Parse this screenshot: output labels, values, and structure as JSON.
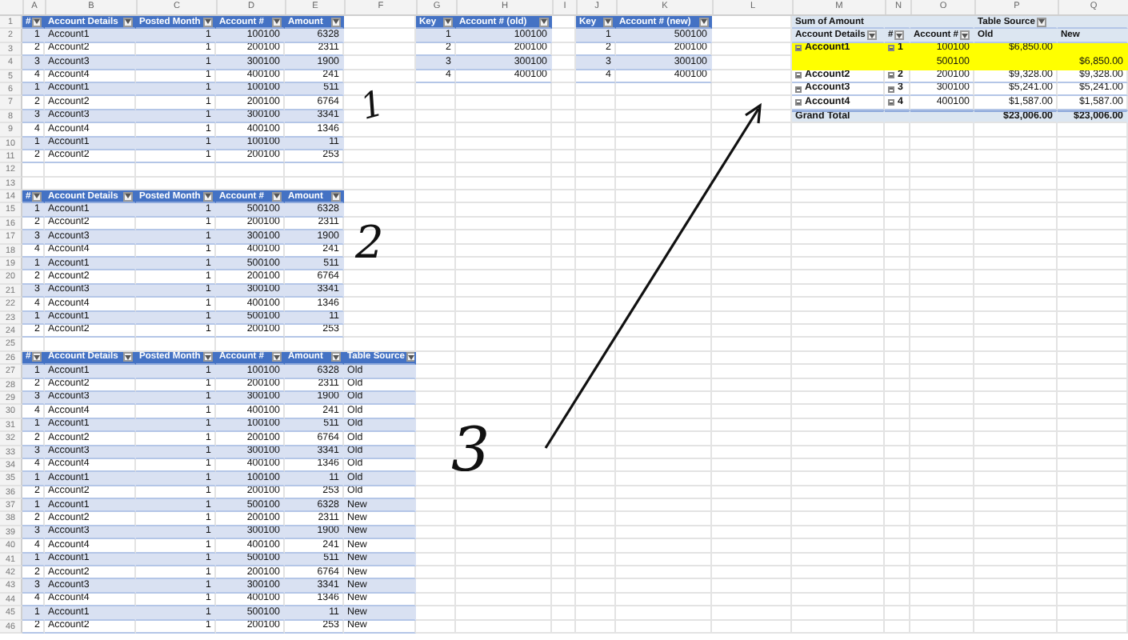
{
  "column_letters": [
    "A",
    "B",
    "C",
    "D",
    "E",
    "F",
    "G",
    "H",
    "I",
    "J",
    "K",
    "L",
    "M",
    "N",
    "O",
    "P",
    "Q"
  ],
  "row_numbers": [
    "1",
    "2",
    "3",
    "4",
    "5",
    "6",
    "7",
    "8",
    "9",
    "10",
    "11",
    "12",
    "13",
    "14",
    "15",
    "16",
    "17",
    "18",
    "19",
    "20",
    "21",
    "22",
    "23",
    "24",
    "25",
    "26",
    "27",
    "28",
    "29",
    "30",
    "31",
    "32",
    "33",
    "34",
    "35",
    "36",
    "37",
    "38",
    "39",
    "40",
    "41",
    "42",
    "43",
    "44",
    "45",
    "46"
  ],
  "tables": [
    {
      "headers": [
        "#",
        "Account Details",
        "Posted Month",
        "Account #",
        "Amount"
      ],
      "rows": [
        [
          "1",
          "Account1",
          "1",
          "100100",
          "6328"
        ],
        [
          "2",
          "Account2",
          "1",
          "200100",
          "2311"
        ],
        [
          "3",
          "Account3",
          "1",
          "300100",
          "1900"
        ],
        [
          "4",
          "Account4",
          "1",
          "400100",
          "241"
        ],
        [
          "1",
          "Account1",
          "1",
          "100100",
          "511"
        ],
        [
          "2",
          "Account2",
          "1",
          "200100",
          "6764"
        ],
        [
          "3",
          "Account3",
          "1",
          "300100",
          "3341"
        ],
        [
          "4",
          "Account4",
          "1",
          "400100",
          "1346"
        ],
        [
          "1",
          "Account1",
          "1",
          "100100",
          "11"
        ],
        [
          "2",
          "Account2",
          "1",
          "200100",
          "253"
        ]
      ]
    },
    {
      "headers": [
        "#",
        "Account Details",
        "Posted Month",
        "Account #",
        "Amount"
      ],
      "rows": [
        [
          "1",
          "Account1",
          "1",
          "500100",
          "6328"
        ],
        [
          "2",
          "Account2",
          "1",
          "200100",
          "2311"
        ],
        [
          "3",
          "Account3",
          "1",
          "300100",
          "1900"
        ],
        [
          "4",
          "Account4",
          "1",
          "400100",
          "241"
        ],
        [
          "1",
          "Account1",
          "1",
          "500100",
          "511"
        ],
        [
          "2",
          "Account2",
          "1",
          "200100",
          "6764"
        ],
        [
          "3",
          "Account3",
          "1",
          "300100",
          "3341"
        ],
        [
          "4",
          "Account4",
          "1",
          "400100",
          "1346"
        ],
        [
          "1",
          "Account1",
          "1",
          "500100",
          "11"
        ],
        [
          "2",
          "Account2",
          "1",
          "200100",
          "253"
        ]
      ]
    },
    {
      "headers": [
        "#",
        "Account Details",
        "Posted Month",
        "Account #",
        "Amount",
        "Table Source"
      ],
      "rows": [
        [
          "1",
          "Account1",
          "1",
          "100100",
          "6328",
          "Old"
        ],
        [
          "2",
          "Account2",
          "1",
          "200100",
          "2311",
          "Old"
        ],
        [
          "3",
          "Account3",
          "1",
          "300100",
          "1900",
          "Old"
        ],
        [
          "4",
          "Account4",
          "1",
          "400100",
          "241",
          "Old"
        ],
        [
          "1",
          "Account1",
          "1",
          "100100",
          "511",
          "Old"
        ],
        [
          "2",
          "Account2",
          "1",
          "200100",
          "6764",
          "Old"
        ],
        [
          "3",
          "Account3",
          "1",
          "300100",
          "3341",
          "Old"
        ],
        [
          "4",
          "Account4",
          "1",
          "400100",
          "1346",
          "Old"
        ],
        [
          "1",
          "Account1",
          "1",
          "100100",
          "11",
          "Old"
        ],
        [
          "2",
          "Account2",
          "1",
          "200100",
          "253",
          "Old"
        ],
        [
          "1",
          "Account1",
          "1",
          "500100",
          "6328",
          "New"
        ],
        [
          "2",
          "Account2",
          "1",
          "200100",
          "2311",
          "New"
        ],
        [
          "3",
          "Account3",
          "1",
          "300100",
          "1900",
          "New"
        ],
        [
          "4",
          "Account4",
          "1",
          "400100",
          "241",
          "New"
        ],
        [
          "1",
          "Account1",
          "1",
          "500100",
          "511",
          "New"
        ],
        [
          "2",
          "Account2",
          "1",
          "200100",
          "6764",
          "New"
        ],
        [
          "3",
          "Account3",
          "1",
          "300100",
          "3341",
          "New"
        ],
        [
          "4",
          "Account4",
          "1",
          "400100",
          "1346",
          "New"
        ],
        [
          "1",
          "Account1",
          "1",
          "500100",
          "11",
          "New"
        ],
        [
          "2",
          "Account2",
          "1",
          "200100",
          "253",
          "New"
        ]
      ]
    },
    {
      "headers": [
        "Key",
        "Account # (old)"
      ],
      "rows": [
        [
          "1",
          "100100"
        ],
        [
          "2",
          "200100"
        ],
        [
          "3",
          "300100"
        ],
        [
          "4",
          "400100"
        ]
      ]
    },
    {
      "headers": [
        "Key",
        "Account # (new)"
      ],
      "rows": [
        [
          "1",
          "500100"
        ],
        [
          "2",
          "200100"
        ],
        [
          "3",
          "300100"
        ],
        [
          "4",
          "400100"
        ]
      ]
    }
  ],
  "pivot": {
    "title": "Sum of Amount",
    "column_field": "Table Source",
    "row_fields": [
      "Account Details",
      "#",
      "Account #"
    ],
    "column_items": [
      "Old",
      "New"
    ],
    "rows": [
      {
        "account": "Account1",
        "key": "1",
        "account_no": "100100",
        "old": "$6,850.00",
        "highlighted": true
      },
      {
        "account_no": "500100",
        "new": "$6,850.00",
        "highlighted": true
      },
      {
        "account": "Account2",
        "key": "2",
        "account_no": "200100",
        "old": "$9,328.00",
        "new": "$9,328.00",
        "highlighted": false
      },
      {
        "account": "Account3",
        "key": "3",
        "account_no": "300100",
        "old": "$5,241.00",
        "new": "$5,241.00",
        "highlighted": false
      },
      {
        "account": "Account4",
        "key": "4",
        "account_no": "400100",
        "old": "$1,587.00",
        "new": "$1,587.00",
        "highlighted": false
      }
    ],
    "grand_total": {
      "label": "Grand Total",
      "old": "$23,006.00",
      "new": "$23,006.00"
    }
  },
  "annotations": [
    "1",
    "2",
    "3"
  ]
}
